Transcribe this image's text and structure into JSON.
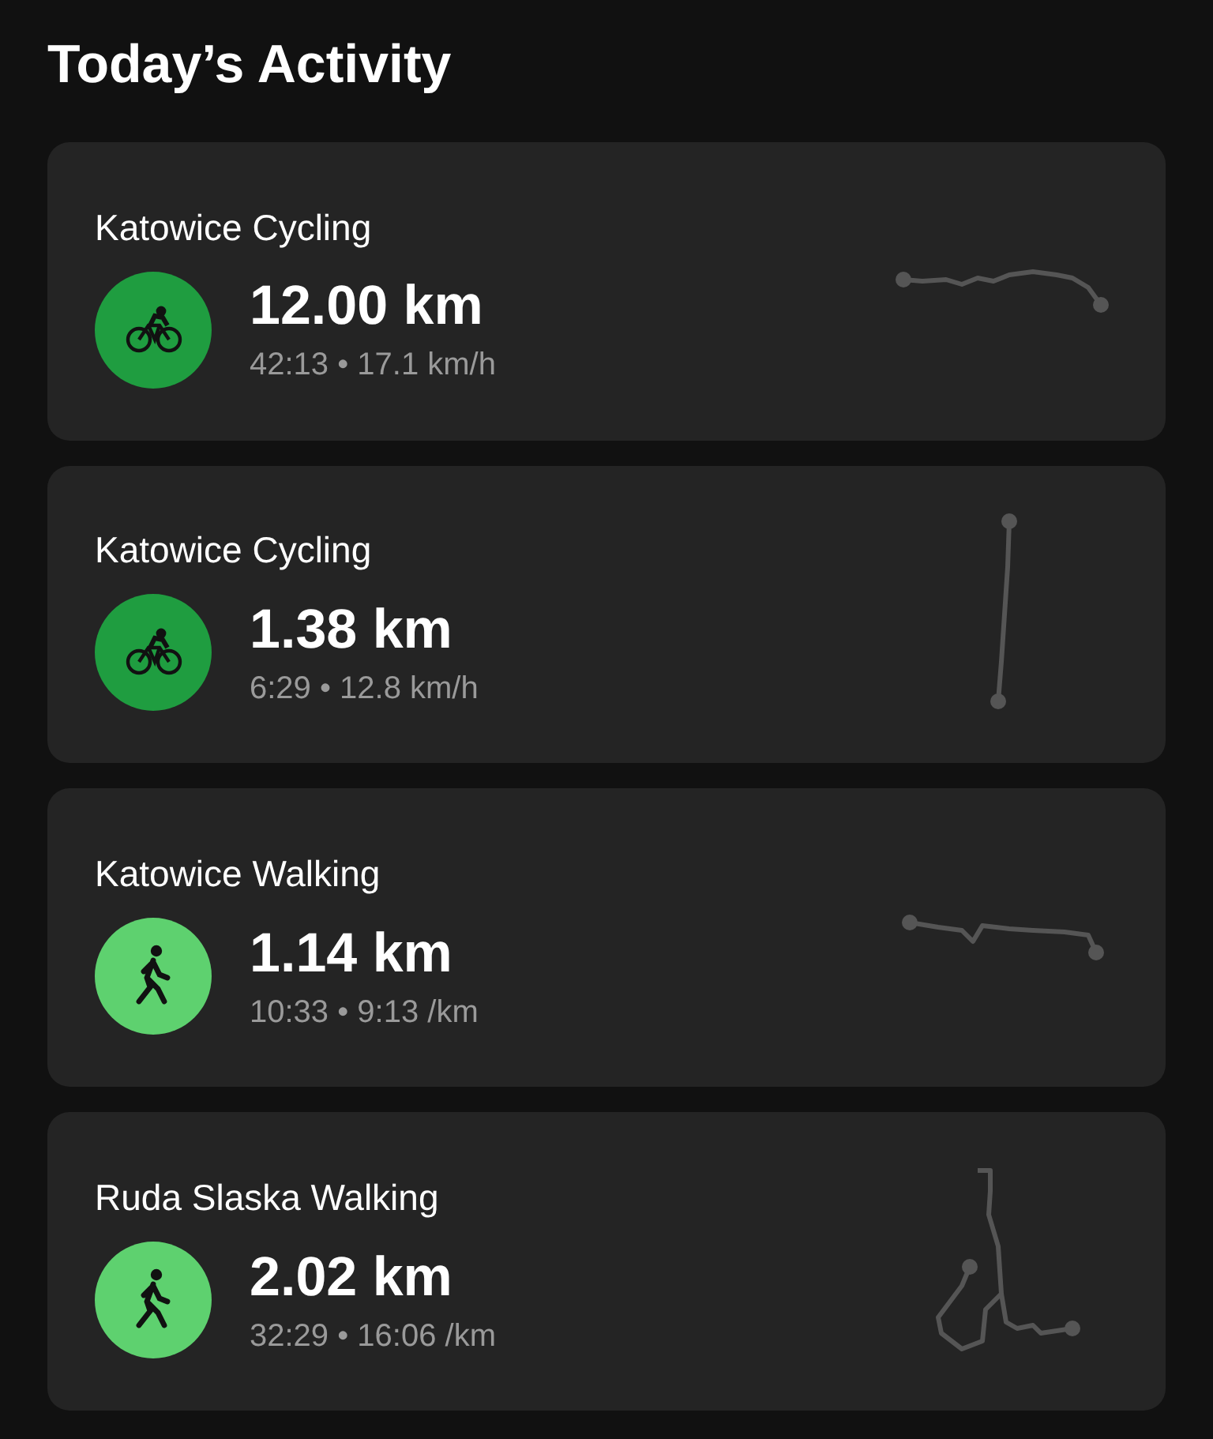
{
  "title": "Today’s Activity",
  "activities": [
    {
      "name": "Katowice Cycling",
      "kind": "cycling",
      "distance": "12.00 km",
      "details": "42:13 • 17.1 km/h"
    },
    {
      "name": "Katowice Cycling",
      "kind": "cycling",
      "distance": "1.38 km",
      "details": "6:29 • 12.8 km/h"
    },
    {
      "name": "Katowice Walking",
      "kind": "walking",
      "distance": "1.14 km",
      "details": "10:33 • 9:13 /km"
    },
    {
      "name": "Ruda Slaska Walking",
      "kind": "walking",
      "distance": "2.02 km",
      "details": "32:29 • 16:06 /km"
    }
  ]
}
